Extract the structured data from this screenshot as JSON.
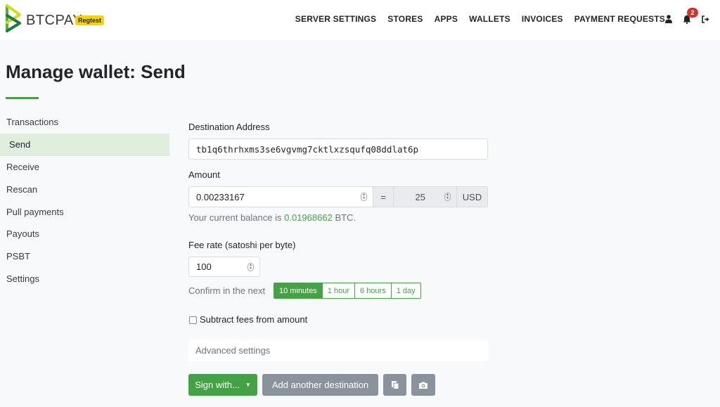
{
  "brand": {
    "name": "BTCPAY",
    "env_badge": "Regtest",
    "accent": "#44a244"
  },
  "nav": {
    "links": [
      "SERVER SETTINGS",
      "STORES",
      "APPS",
      "WALLETS",
      "INVOICES",
      "PAYMENT REQUESTS"
    ],
    "icons": [
      "user-icon",
      "bell-icon",
      "logout-icon"
    ],
    "notification_count": "2"
  },
  "page": {
    "title": "Manage wallet: Send"
  },
  "sidebar": {
    "items": [
      {
        "label": "Transactions"
      },
      {
        "label": "Send",
        "active": true
      },
      {
        "label": "Receive"
      },
      {
        "label": "Rescan"
      },
      {
        "label": "Pull payments"
      },
      {
        "label": "Payouts"
      },
      {
        "label": "PSBT"
      },
      {
        "label": "Settings"
      }
    ]
  },
  "form": {
    "destination_label": "Destination Address",
    "destination_value": "tb1q6thrhxms3se6vgvmg7cktlxzsqufq08ddlat6p",
    "amount_label": "Amount",
    "amount_value": "0.00233167",
    "equals": "=",
    "fiat_value": "25",
    "fiat_currency": "USD",
    "balance_prefix": "Your current balance is",
    "balance_value": "0.01968662",
    "balance_suffix": "BTC.",
    "fee_label": "Fee rate (satoshi per byte)",
    "fee_value": "100",
    "confirm_prefix": "Confirm in the next",
    "confirm_options": [
      "10 minutes",
      "1 hour",
      "6 hours",
      "1 day"
    ],
    "confirm_selected": "10 minutes",
    "subtract_fees_label": "Subtract fees from amount",
    "subtract_fees_checked": false,
    "advanced_label": "Advanced settings"
  },
  "actions": {
    "sign_label": "Sign with...",
    "add_destination_label": "Add another destination",
    "paste_icon": "clipboard-icon",
    "scan_icon": "camera-icon"
  }
}
